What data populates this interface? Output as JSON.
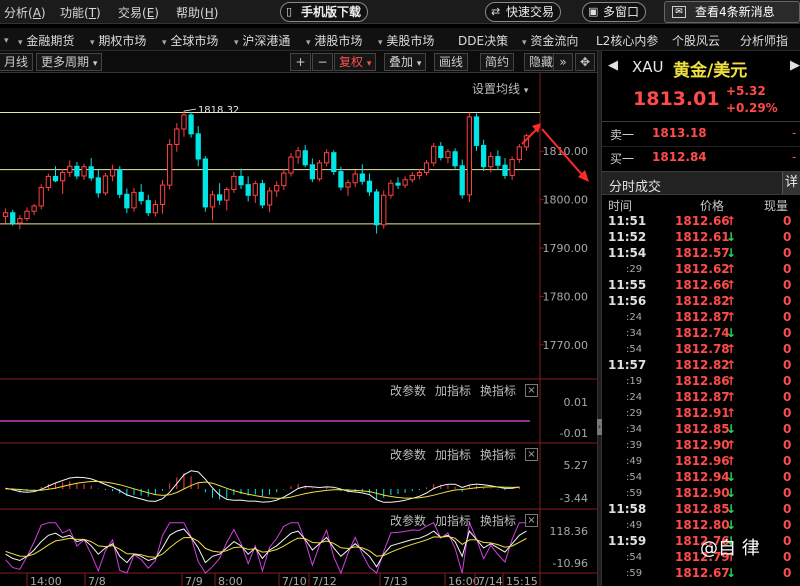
{
  "menu": {
    "items": [
      {
        "label": "分析",
        "key": "A"
      },
      {
        "label": "功能",
        "key": "T"
      },
      {
        "label": "交易",
        "key": "E"
      },
      {
        "label": "帮助",
        "key": "H"
      }
    ],
    "mobile_download": "手机版下载",
    "quick_trade": "快速交易",
    "multi_window": "多窗口",
    "news_button": "查看4条新消息"
  },
  "nav": {
    "items": [
      "金融期货",
      "期权市场",
      "全球市场",
      "沪深港通",
      "港股市场",
      "美股市场",
      "DDE决策",
      "资金流向",
      "L2核心内参",
      "个股风云",
      "分析师指"
    ]
  },
  "toolbar": {
    "period": "月线",
    "more_periods": "更多周期",
    "plus": "+",
    "minus": "−",
    "adjust": "复权",
    "overlay": "叠加",
    "draw_line": "画线",
    "simple": "简约",
    "hide": "隐藏",
    "expand": "»"
  },
  "chart": {
    "ma_setting": "设置均线",
    "high_label": "1818.32",
    "indicator_links": {
      "change_params": "改参数",
      "add_indicator": "加指标",
      "switch_indicator": "换指标",
      "close": "×"
    },
    "panels": [
      {
        "labels": [
          "0.01",
          "-0.01"
        ]
      },
      {
        "labels": [
          "5.27",
          "-3.44"
        ]
      },
      {
        "labels": [
          "118.36",
          "-10.96"
        ]
      }
    ],
    "x_labels": [
      "14:00",
      "7/8",
      "7/9",
      "8:00",
      "7/10",
      "7/12",
      "7/13",
      "16:00",
      "7/14",
      "15:15"
    ]
  },
  "chart_data": {
    "type": "candlestick",
    "title": "",
    "y_ticks": [
      1810.0,
      1800.0,
      1790.0,
      1780.0,
      1770.0
    ],
    "ylim": [
      1764.6,
      1821.0
    ],
    "hlines": [
      1818.0,
      1806.2,
      1795.0
    ],
    "colors": {
      "up": "#ff4040",
      "down": "#00e5e5",
      "hline": "#e8e8a0",
      "zero": "#c040c0"
    },
    "candles": [
      [
        1796.5,
        1798.2,
        1795.1,
        1797.3
      ],
      [
        1797.3,
        1797.9,
        1794.6,
        1795.2
      ],
      [
        1795.2,
        1796.8,
        1793.9,
        1796.1
      ],
      [
        1796.1,
        1798.4,
        1795.6,
        1797.6
      ],
      [
        1797.6,
        1799.1,
        1796.8,
        1798.7
      ],
      [
        1798.7,
        1803.2,
        1798.0,
        1802.5
      ],
      [
        1802.5,
        1805.4,
        1801.8,
        1804.8
      ],
      [
        1804.8,
        1806.9,
        1803.6,
        1803.9
      ],
      [
        1803.9,
        1806.3,
        1801.2,
        1805.6
      ],
      [
        1805.6,
        1808.1,
        1804.7,
        1806.9
      ],
      [
        1806.9,
        1807.8,
        1804.2,
        1804.9
      ],
      [
        1804.9,
        1807.4,
        1804.1,
        1806.8
      ],
      [
        1806.8,
        1808.6,
        1803.9,
        1804.5
      ],
      [
        1804.5,
        1806.2,
        1800.4,
        1801.4
      ],
      [
        1801.4,
        1805.5,
        1800.9,
        1804.9
      ],
      [
        1804.9,
        1807.2,
        1803.8,
        1806.2
      ],
      [
        1806.2,
        1806.9,
        1800.3,
        1801.1
      ],
      [
        1801.1,
        1802.3,
        1797.2,
        1798.3
      ],
      [
        1798.3,
        1802.4,
        1797.5,
        1801.5
      ],
      [
        1801.5,
        1803.2,
        1799.0,
        1799.8
      ],
      [
        1799.8,
        1801.0,
        1796.6,
        1797.3
      ],
      [
        1797.3,
        1799.9,
        1796.5,
        1799.0
      ],
      [
        1799.0,
        1804.1,
        1797.1,
        1803.0
      ],
      [
        1803.0,
        1812.5,
        1802.1,
        1811.4
      ],
      [
        1811.4,
        1815.8,
        1809.9,
        1814.6
      ],
      [
        1814.6,
        1818.3,
        1813.0,
        1817.5
      ],
      [
        1817.5,
        1818.1,
        1812.8,
        1813.6
      ],
      [
        1813.6,
        1815.2,
        1806.9,
        1808.4
      ],
      [
        1808.4,
        1809.0,
        1797.5,
        1798.5
      ],
      [
        1798.5,
        1801.8,
        1795.7,
        1801.0
      ],
      [
        1801.0,
        1803.4,
        1798.9,
        1799.9
      ],
      [
        1799.9,
        1802.6,
        1797.8,
        1802.1
      ],
      [
        1802.1,
        1805.7,
        1801.4,
        1804.8
      ],
      [
        1804.8,
        1806.4,
        1802.2,
        1803.1
      ],
      [
        1803.1,
        1804.8,
        1799.6,
        1800.9
      ],
      [
        1800.9,
        1803.9,
        1799.3,
        1803.3
      ],
      [
        1803.3,
        1804.1,
        1798.2,
        1798.9
      ],
      [
        1798.9,
        1802.5,
        1797.4,
        1801.8
      ],
      [
        1801.8,
        1803.8,
        1800.6,
        1802.9
      ],
      [
        1802.9,
        1806.2,
        1802.0,
        1805.5
      ],
      [
        1805.5,
        1809.6,
        1804.8,
        1808.8
      ],
      [
        1808.8,
        1810.9,
        1807.4,
        1810.1
      ],
      [
        1810.1,
        1811.3,
        1806.7,
        1807.2
      ],
      [
        1807.2,
        1808.5,
        1803.6,
        1804.3
      ],
      [
        1804.3,
        1808.2,
        1803.8,
        1807.6
      ],
      [
        1807.6,
        1810.4,
        1806.9,
        1809.7
      ],
      [
        1809.7,
        1810.2,
        1805.1,
        1805.8
      ],
      [
        1805.8,
        1806.8,
        1801.9,
        1802.6
      ],
      [
        1802.6,
        1804.1,
        1800.8,
        1803.5
      ],
      [
        1803.5,
        1806.1,
        1802.6,
        1805.3
      ],
      [
        1805.3,
        1807.3,
        1803.1,
        1803.8
      ],
      [
        1803.8,
        1805.4,
        1800.8,
        1801.6
      ],
      [
        1801.6,
        1802.2,
        1793.0,
        1794.8
      ],
      [
        1794.8,
        1801.9,
        1794.0,
        1800.9
      ],
      [
        1800.9,
        1804.1,
        1800.2,
        1803.4
      ],
      [
        1803.4,
        1804.6,
        1802.2,
        1803.0
      ],
      [
        1803.0,
        1804.8,
        1802.4,
        1804.1
      ],
      [
        1804.1,
        1805.7,
        1803.5,
        1805.0
      ],
      [
        1805.0,
        1806.3,
        1804.2,
        1805.6
      ],
      [
        1805.6,
        1808.2,
        1805.0,
        1807.6
      ],
      [
        1807.6,
        1811.7,
        1806.9,
        1811.0
      ],
      [
        1811.0,
        1811.9,
        1808.1,
        1808.7
      ],
      [
        1808.7,
        1810.5,
        1807.5,
        1809.9
      ],
      [
        1809.9,
        1810.6,
        1806.4,
        1807.0
      ],
      [
        1807.0,
        1808.3,
        1800.2,
        1801.0
      ],
      [
        1801.0,
        1818.0,
        1799.5,
        1817.1
      ],
      [
        1817.1,
        1817.8,
        1810.1,
        1811.2
      ],
      [
        1811.2,
        1812.4,
        1805.9,
        1806.8
      ],
      [
        1806.8,
        1809.8,
        1805.6,
        1808.9
      ],
      [
        1808.9,
        1810.2,
        1806.2,
        1807.1
      ],
      [
        1807.1,
        1808.6,
        1804.3,
        1805.0
      ],
      [
        1805.0,
        1808.9,
        1804.1,
        1808.3
      ],
      [
        1808.3,
        1811.5,
        1807.6,
        1810.9
      ],
      [
        1810.9,
        1813.6,
        1810.1,
        1813.2
      ]
    ],
    "macd_hist": [
      0.2,
      -0.3,
      -0.6,
      -0.4,
      -0.1,
      0.4,
      0.9,
      1.1,
      1.2,
      1.4,
      1.1,
      0.9,
      0.6,
      0.1,
      -0.2,
      -0.4,
      -0.8,
      -1.3,
      -1.1,
      -1.2,
      -1.4,
      -1.1,
      -0.3,
      1.0,
      2.1,
      2.9,
      2.3,
      1.2,
      -0.6,
      -1.6,
      -1.9,
      -1.7,
      -1.1,
      -0.9,
      -1.2,
      -1.0,
      -1.3,
      -1.0,
      -0.6,
      -0.1,
      0.5,
      0.9,
      0.6,
      0.1,
      0.0,
      0.3,
      0.1,
      -0.4,
      -0.6,
      -0.4,
      -0.5,
      -0.8,
      -1.9,
      -1.6,
      -1.1,
      -0.9,
      -0.7,
      -0.4,
      -0.2,
      0.3,
      0.9,
      0.8,
      0.7,
      0.4,
      -0.5,
      0.8,
      0.6,
      0.2,
      0.1,
      -0.1,
      -0.2,
      0.1,
      0.4
    ],
    "kdj_k": [
      40,
      30,
      25,
      35,
      50,
      70,
      85,
      90,
      80,
      85,
      70,
      75,
      60,
      40,
      55,
      65,
      35,
      20,
      40,
      35,
      25,
      30,
      55,
      85,
      95,
      100,
      80,
      55,
      20,
      35,
      40,
      55,
      70,
      60,
      40,
      55,
      30,
      50,
      60,
      75,
      90,
      95,
      75,
      50,
      65,
      80,
      55,
      35,
      50,
      65,
      50,
      35,
      10,
      40,
      60,
      65,
      70,
      75,
      78,
      85,
      95,
      80,
      85,
      70,
      35,
      95,
      75,
      55,
      65,
      55,
      45,
      65,
      85,
      95
    ]
  },
  "side": {
    "symbol": "XAU",
    "name": "黄金/美元",
    "price": "1813.01",
    "change": "+5.32",
    "change_pct": "+0.29%",
    "sell_label": "卖一",
    "sell_price": "1813.18",
    "buy_label": "买一",
    "buy_price": "1812.84",
    "trades_title": "分时成交",
    "detail": "详",
    "columns": {
      "time": "时间",
      "price": "价格",
      "volume": "现量"
    },
    "ticks": [
      {
        "time": "11:51",
        "price": "1812.66",
        "dir": "up",
        "vol": "0"
      },
      {
        "time": "11:52",
        "price": "1812.61",
        "dir": "down",
        "vol": "0"
      },
      {
        "time": "11:54",
        "price": "1812.57",
        "dir": "down",
        "vol": "0"
      },
      {
        "time": ":29",
        "price": "1812.62",
        "dir": "up",
        "vol": "0"
      },
      {
        "time": "11:55",
        "price": "1812.66",
        "dir": "up",
        "vol": "0"
      },
      {
        "time": "11:56",
        "price": "1812.82",
        "dir": "up",
        "vol": "0"
      },
      {
        "time": ":24",
        "price": "1812.87",
        "dir": "up",
        "vol": "0"
      },
      {
        "time": ":34",
        "price": "1812.74",
        "dir": "down",
        "vol": "0"
      },
      {
        "time": ":54",
        "price": "1812.78",
        "dir": "up",
        "vol": "0"
      },
      {
        "time": "11:57",
        "price": "1812.82",
        "dir": "up",
        "vol": "0"
      },
      {
        "time": ":19",
        "price": "1812.86",
        "dir": "up",
        "vol": "0"
      },
      {
        "time": ":24",
        "price": "1812.87",
        "dir": "up",
        "vol": "0"
      },
      {
        "time": ":29",
        "price": "1812.91",
        "dir": "up",
        "vol": "0"
      },
      {
        "time": ":34",
        "price": "1812.85",
        "dir": "down",
        "vol": "0"
      },
      {
        "time": ":39",
        "price": "1812.90",
        "dir": "up",
        "vol": "0"
      },
      {
        "time": ":49",
        "price": "1812.96",
        "dir": "up",
        "vol": "0"
      },
      {
        "time": ":54",
        "price": "1812.94",
        "dir": "down",
        "vol": "0"
      },
      {
        "time": ":59",
        "price": "1812.90",
        "dir": "down",
        "vol": "0"
      },
      {
        "time": "11:58",
        "price": "1812.85",
        "dir": "down",
        "vol": "0"
      },
      {
        "time": ":49",
        "price": "1812.80",
        "dir": "down",
        "vol": "0"
      },
      {
        "time": "11:59",
        "price": "1812.76",
        "dir": "down",
        "vol": "0"
      },
      {
        "time": ":54",
        "price": "1812.79",
        "dir": "up",
        "vol": "0"
      },
      {
        "time": ":59",
        "price": "1812.67",
        "dir": "down",
        "vol": "0"
      }
    ]
  },
  "watermark": "@自 律"
}
